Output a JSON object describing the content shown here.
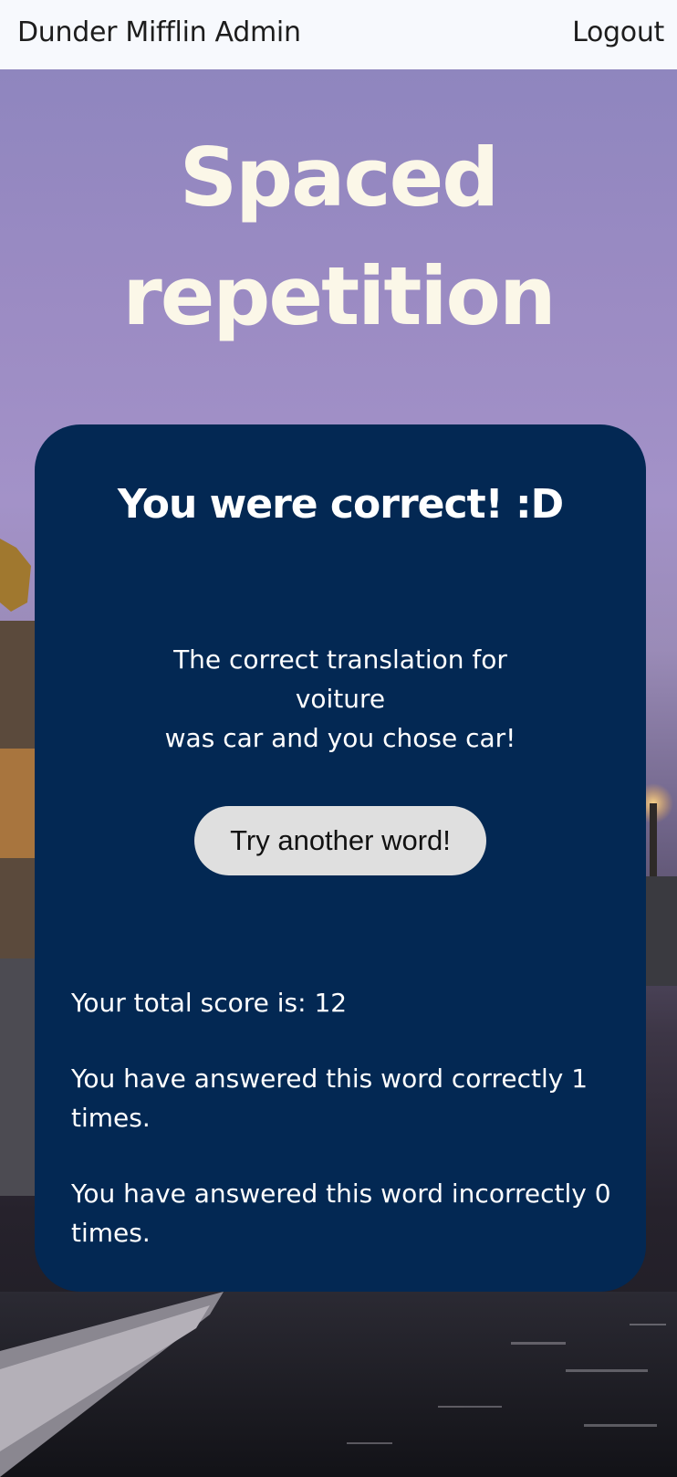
{
  "navbar": {
    "brand": "Dunder Mifflin Admin",
    "logout": "Logout"
  },
  "hero": {
    "title_line1": "Spaced",
    "title_line2": "repetition"
  },
  "card": {
    "heading": "You were correct! :D",
    "feedback_line1": "The correct translation for",
    "original_word": "voiture",
    "feedback_line3": "was car and you chose car!",
    "try_button": "Try another word!",
    "total_score": "Your total score is: 12",
    "correct_count": "You have answered this word correctly 1 times.",
    "incorrect_count": "You have answered this word incorrectly 0 times."
  },
  "colors": {
    "card_bg": "#032853",
    "title_color": "#fbf7e8",
    "navbar_bg": "#f7f9fd",
    "button_bg": "#dfdfdf"
  }
}
